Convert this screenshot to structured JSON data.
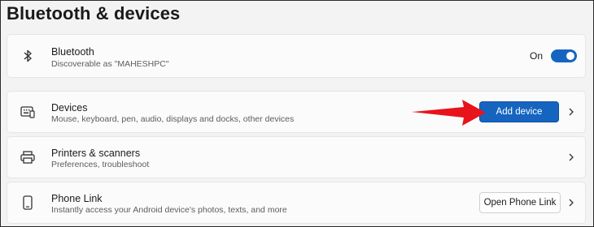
{
  "page": {
    "title": "Bluetooth & devices"
  },
  "bluetooth": {
    "title": "Bluetooth",
    "subtitle": "Discoverable as \"MAHESHPC\"",
    "toggle_label": "On",
    "toggle_state": "on",
    "icon": "bluetooth-icon"
  },
  "devices": {
    "title": "Devices",
    "subtitle": "Mouse, keyboard, pen, audio, displays and docks, other devices",
    "button_label": "Add device",
    "icon": "devices-icon"
  },
  "printers": {
    "title": "Printers & scanners",
    "subtitle": "Preferences, troubleshoot",
    "icon": "printer-icon"
  },
  "phone_link": {
    "title": "Phone Link",
    "subtitle": "Instantly access your Android device's photos, texts, and more",
    "button_label": "Open Phone Link",
    "icon": "phone-icon"
  },
  "colors": {
    "accent": "#1565c0",
    "annotation_arrow": "#e8141c",
    "background": "#f3f3f3",
    "card": "#fbfbfb"
  }
}
